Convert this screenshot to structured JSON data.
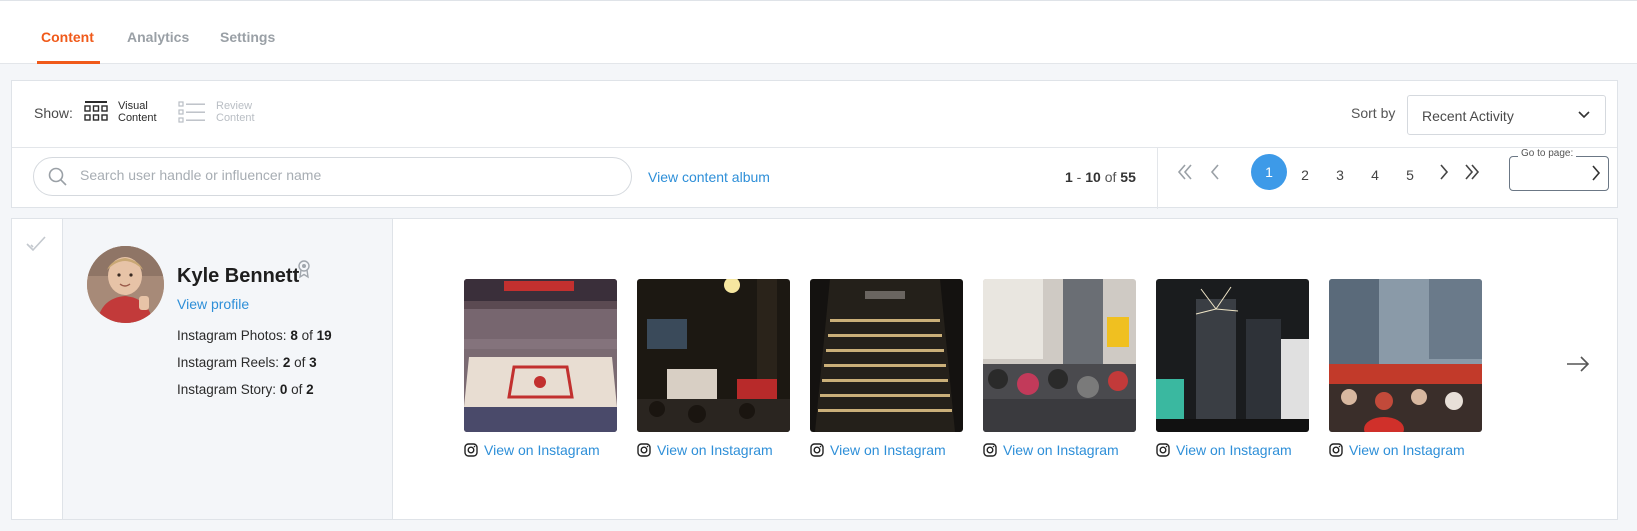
{
  "tabs": [
    {
      "label": "Content",
      "active": true
    },
    {
      "label": "Analytics",
      "active": false
    },
    {
      "label": "Settings",
      "active": false
    }
  ],
  "toolbar": {
    "show_label": "Show:",
    "view_options": [
      {
        "line1": "Visual",
        "line2": "Content",
        "active": true,
        "icon": "grid-icon"
      },
      {
        "line1": "Review",
        "line2": "Content",
        "active": false,
        "icon": "list-icon"
      }
    ],
    "sort_label": "Sort by",
    "sort_value": "Recent Activity"
  },
  "search": {
    "placeholder": "Search user handle or influencer name",
    "value": ""
  },
  "album_link": "View content album",
  "range": {
    "start": "1",
    "end": "10",
    "of": "of",
    "total": "55"
  },
  "pagination": {
    "current": "1",
    "pages": [
      "2",
      "3",
      "4",
      "5"
    ],
    "goto_label": "Go to page:"
  },
  "influencer": {
    "name": "Kyle Bennett",
    "view_profile": "View profile",
    "stats": [
      {
        "label": "Instagram Photos:",
        "count": "8",
        "of": "of",
        "total": "19"
      },
      {
        "label": "Instagram Reels:",
        "count": "2",
        "of": "of",
        "total": "3"
      },
      {
        "label": "Instagram Story:",
        "count": "0",
        "of": "of",
        "total": "2"
      }
    ]
  },
  "posts": [
    {
      "link_label": "View on Instagram",
      "scene": "basketball-arena"
    },
    {
      "link_label": "View on Instagram",
      "scene": "night-street-crowd"
    },
    {
      "link_label": "View on Instagram",
      "scene": "office-tower-night"
    },
    {
      "link_label": "View on Instagram",
      "scene": "street-crowd-day"
    },
    {
      "link_label": "View on Instagram",
      "scene": "fireworks-towers"
    },
    {
      "link_label": "View on Instagram",
      "scene": "parade-crowd"
    }
  ],
  "colors": {
    "accent": "#f05a1a",
    "link": "#2e8fd8",
    "active_page": "#3d9ae8"
  }
}
